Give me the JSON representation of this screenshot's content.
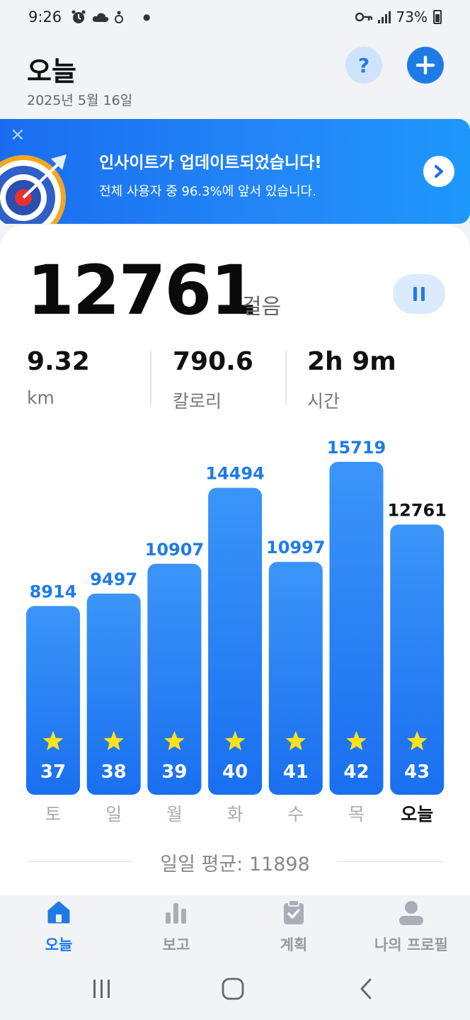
{
  "status_bar": {
    "time": "9:26",
    "battery": "73%",
    "icons": [
      "alarm-icon",
      "cloud-icon",
      "app-icon",
      "dot-icon",
      "key-icon",
      "signal-icon",
      "battery-icon"
    ]
  },
  "header": {
    "title": "오늘",
    "date": "2025년 5월 16일",
    "help_label": "?",
    "add_icon": "plus-icon"
  },
  "banner": {
    "title": "인사이트가 업데이트되었습니다!",
    "subtitle": "전체 사용자 중 96.3%에 앞서 있습니다.",
    "close_icon": "close-icon",
    "arrow_icon": "chevron-right-icon"
  },
  "steps": {
    "value": "12761",
    "unit": "걸음"
  },
  "stats": [
    {
      "value": "9.32",
      "label": "km"
    },
    {
      "value": "790.6",
      "label": "칼로리"
    },
    {
      "value": "2h 9m",
      "label": "시간"
    }
  ],
  "chart_data": {
    "type": "bar",
    "categories": [
      "토",
      "일",
      "월",
      "화",
      "수",
      "목",
      "오늘"
    ],
    "values": [
      8914,
      9497,
      10907,
      14494,
      10997,
      15719,
      12761
    ],
    "badges": [
      "37",
      "38",
      "39",
      "40",
      "41",
      "42",
      "43"
    ],
    "highlight_index": 6,
    "title": "",
    "xlabel": "",
    "ylabel": "",
    "grid": false
  },
  "average": {
    "text": "일일 평균: 11898"
  },
  "bottom_nav": {
    "items": [
      {
        "label": "오늘",
        "icon": "home-icon",
        "active": true
      },
      {
        "label": "보고",
        "icon": "bar-chart-icon",
        "active": false
      },
      {
        "label": "계획",
        "icon": "clipboard-check-icon",
        "active": false
      },
      {
        "label": "나의 프로필",
        "icon": "profile-icon",
        "active": false
      }
    ]
  },
  "system_nav": {
    "icons": [
      "recent-apps-icon",
      "home-circle-icon",
      "back-icon"
    ]
  },
  "colors": {
    "accent": "#1e7be6",
    "bar_top": "#3b95f8",
    "bar_bottom": "#1a6ff0",
    "star": "#ffe21a",
    "background": "#f1f3f7"
  }
}
